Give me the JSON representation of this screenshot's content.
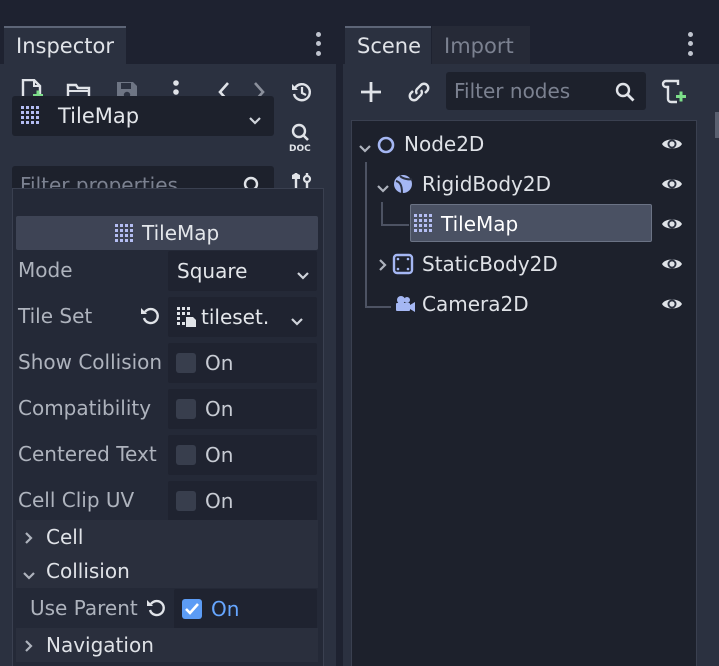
{
  "inspector": {
    "tab_label": "Inspector",
    "selected_node": "TileMap",
    "filter_placeholder": "Filter properties",
    "section_title": "TileMap",
    "properties": [
      {
        "label": "Mode",
        "value": "Square"
      },
      {
        "label": "Tile Set",
        "value": "tileset."
      },
      {
        "label": "Show Collision",
        "value": "On",
        "checked": false
      },
      {
        "label": "Compatibility",
        "value": "On",
        "checked": false
      },
      {
        "label": "Centered Text",
        "value": "On",
        "checked": false
      },
      {
        "label": "Cell Clip UV",
        "value": "On",
        "checked": false
      }
    ],
    "groups": [
      {
        "label": "Cell",
        "expanded": false
      },
      {
        "label": "Collision",
        "expanded": true
      },
      {
        "label": "Navigation",
        "expanded": false
      }
    ],
    "collision_use_parent": {
      "label": "Use Parent",
      "value": "On",
      "checked": true
    },
    "toolbar_icons": [
      "new-script-icon",
      "open-folder-icon",
      "save-icon",
      "more-icon",
      "history-back-icon",
      "history-forward-icon",
      "history-icon"
    ]
  },
  "scene": {
    "tabs": [
      {
        "label": "Scene",
        "active": true
      },
      {
        "label": "Import",
        "active": false
      }
    ],
    "filter_placeholder": "Filter nodes",
    "nodes": [
      {
        "name": "Node2D",
        "icon": "node2d-icon",
        "depth": 0,
        "expanded": true,
        "visible": true
      },
      {
        "name": "RigidBody2D",
        "icon": "rigidbody2d-icon",
        "depth": 1,
        "expanded": true,
        "visible": true
      },
      {
        "name": "TileMap",
        "icon": "tilemap-icon",
        "depth": 2,
        "selected": true,
        "visible": true
      },
      {
        "name": "StaticBody2D",
        "icon": "staticbody2d-icon",
        "depth": 1,
        "expanded": false,
        "visible": true
      },
      {
        "name": "Camera2D",
        "icon": "camera2d-icon",
        "depth": 1,
        "visible": true
      }
    ]
  },
  "colors": {
    "accent": "#5c9cf5",
    "panel": "#2b3140",
    "field": "#1d212c"
  }
}
